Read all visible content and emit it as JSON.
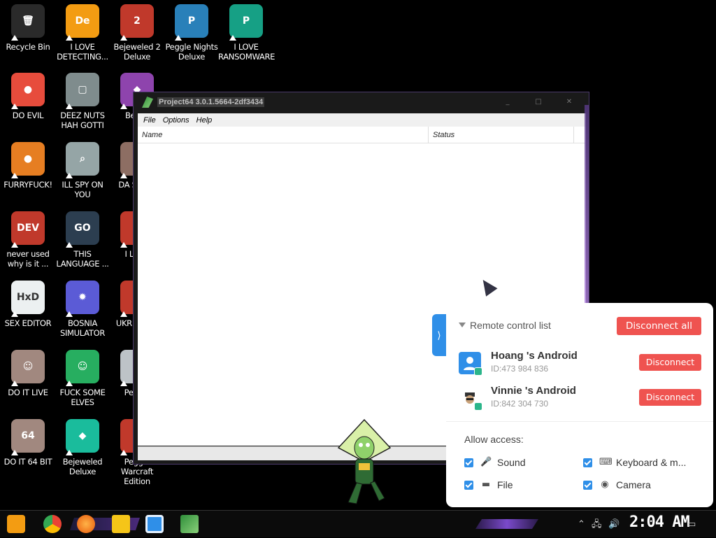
{
  "desktop": {
    "icons": [
      {
        "label": "Recycle Bin",
        "color": "#2a2a2a",
        "glyph": "🗑"
      },
      {
        "label": "I LOVE DETECTING...",
        "color": "#f39c12",
        "glyph": "De"
      },
      {
        "label": "Bejeweled 2 Deluxe",
        "color": "#c0392b",
        "glyph": "2"
      },
      {
        "label": "Peggle Nights Deluxe",
        "color": "#2980b9",
        "glyph": "P"
      },
      {
        "label": "I LOVE RANSOMWARE",
        "color": "#16a085",
        "glyph": "P"
      },
      {
        "label": "DO EVIL",
        "color": "#e74c3c",
        "glyph": "●"
      },
      {
        "label": "DEEZ NUTS HAH GOTTI",
        "color": "#7f8c8d",
        "glyph": "▢"
      },
      {
        "label": "Beje T",
        "color": "#8e44ad",
        "glyph": "◆"
      },
      {
        "label": "FURRYFUCK!",
        "color": "#e67e22",
        "glyph": "●"
      },
      {
        "label": "ILL SPY ON YOU",
        "color": "#95a5a6",
        "glyph": "⌕"
      },
      {
        "label": "DA SIMUL",
        "color": "#8d6e63",
        "glyph": "●"
      },
      {
        "label": "never used why is it ...",
        "color": "#c0392b",
        "glyph": "DEV"
      },
      {
        "label": "THIS LANGUAGE ...",
        "color": "#2c3e50",
        "glyph": "GO"
      },
      {
        "label": "I L CHI",
        "color": "#c0392b",
        "glyph": "●"
      },
      {
        "label": "SEX EDITOR",
        "color": "#ecf0f1",
        "glyph": "HxD"
      },
      {
        "label": "BOSNIA SIMULATOR",
        "color": "#5b5bd6",
        "glyph": "✹"
      },
      {
        "label": "UKR SIMUL",
        "color": "#c0392b",
        "glyph": "●"
      },
      {
        "label": "DO IT LIVE",
        "color": "#a1887f",
        "glyph": "☺"
      },
      {
        "label": "FUCK SOME ELVES",
        "color": "#27ae60",
        "glyph": "☺"
      },
      {
        "label": "Peggle",
        "color": "#bdc3c7",
        "glyph": "●"
      },
      {
        "label": "DO IT 64 BIT",
        "color": "#a1887f",
        "glyph": "64"
      },
      {
        "label": "Bejeweled Deluxe",
        "color": "#1abc9c",
        "glyph": "◆"
      },
      {
        "label": "Peggle Warcraft Edition",
        "color": "#c0392b",
        "glyph": "●"
      }
    ]
  },
  "window": {
    "title": "Project64 3.0.1.5664-2df3434",
    "menu": [
      "File",
      "Options",
      "Help"
    ],
    "columns": [
      "Name",
      "Status"
    ],
    "controls": [
      "_",
      "□",
      "✕"
    ]
  },
  "remote_panel": {
    "handle_glyph": "⟩",
    "header": "Remote control list",
    "disconnect_all": "Disconnect all",
    "connections": [
      {
        "name": "Hoang 's Android",
        "id": "ID:473 984 836",
        "button": "Disconnect",
        "avatar_color": "#2f8fe8"
      },
      {
        "name": "Vinnie 's Android",
        "id": "ID:842 304 730",
        "button": "Disconnect",
        "avatar_color": "#ffffff"
      }
    ],
    "allow_access_label": "Allow access:",
    "options": [
      {
        "label": "Sound",
        "icon": "microphone-icon",
        "glyph": "🎤"
      },
      {
        "label": "Keyboard & m...",
        "icon": "keyboard-icon",
        "glyph": "⌨"
      },
      {
        "label": "File",
        "icon": "folder-icon",
        "glyph": "▬"
      },
      {
        "label": "Camera",
        "icon": "camera-icon",
        "glyph": "◉"
      }
    ],
    "accent": "#2f8fe8",
    "danger": "#ef5350"
  },
  "taskbar": {
    "clock": "2:04 AM",
    "tray": [
      "⌃",
      "🖧",
      "🔊"
    ],
    "notification_glyph": "▭"
  }
}
